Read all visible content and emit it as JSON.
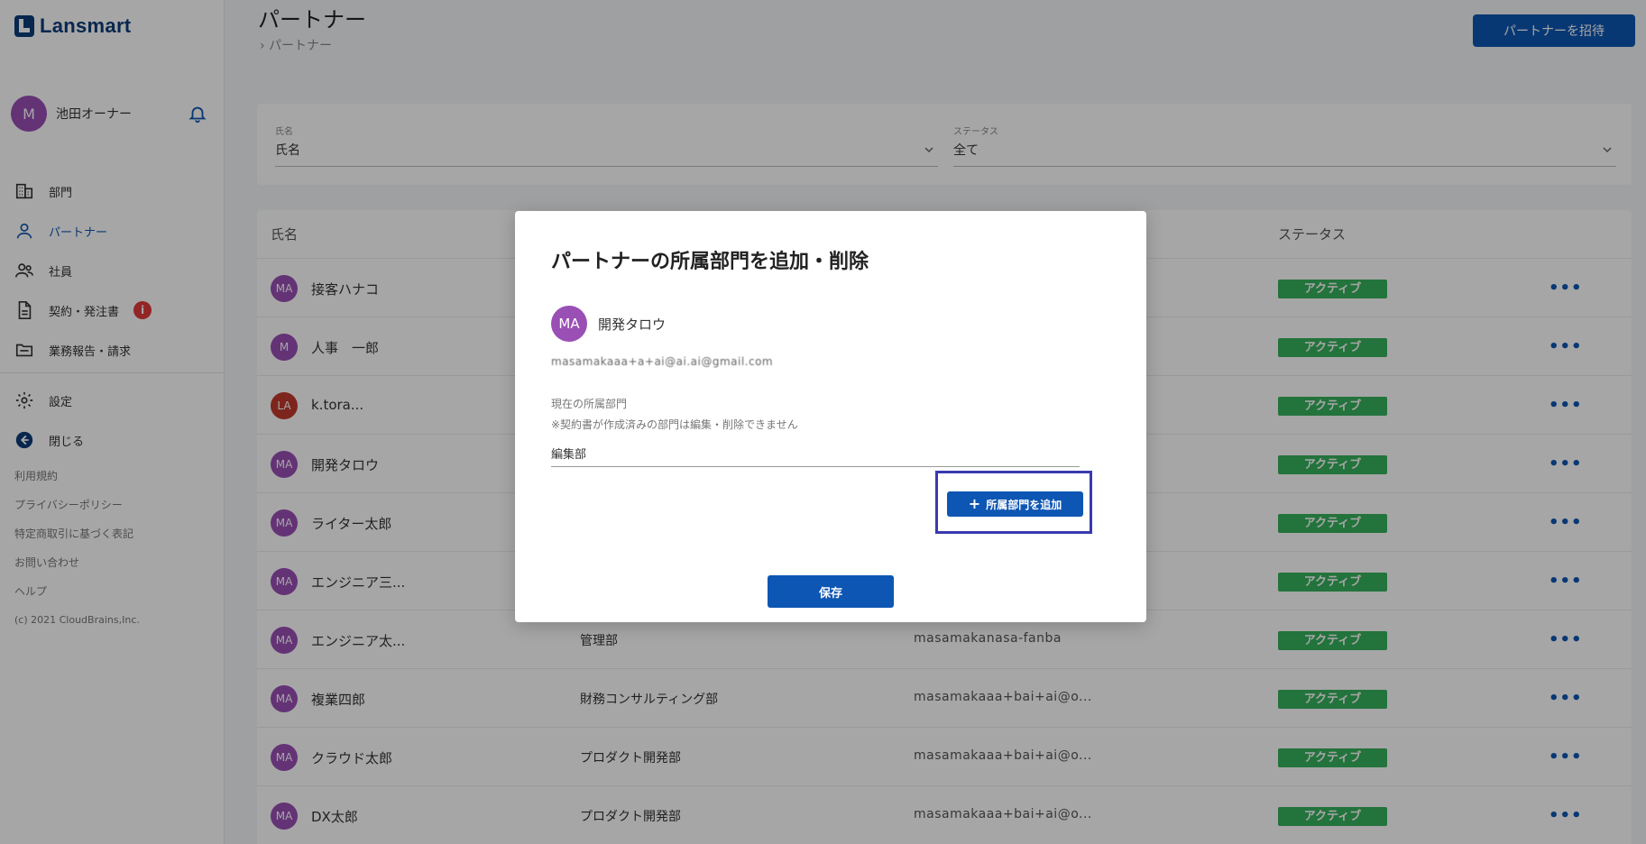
{
  "app": {
    "logo_text": "Lansmart"
  },
  "user": {
    "initial": "M",
    "name": "池田オーナー"
  },
  "nav": {
    "items": [
      {
        "label": "部門",
        "icon": "building-icon"
      },
      {
        "label": "パートナー",
        "icon": "person-icon",
        "active": true
      },
      {
        "label": "社員",
        "icon": "people-icon"
      },
      {
        "label": "契約・発注書",
        "icon": "document-icon",
        "badge": "i"
      },
      {
        "label": "業務報告・請求",
        "icon": "folder-icon"
      }
    ],
    "bottom": [
      {
        "label": "設定",
        "icon": "gear-icon"
      },
      {
        "label": "閉じる",
        "icon": "arrow-left-circle-icon"
      }
    ],
    "links": [
      "利用規約",
      "プライバシーポリシー",
      "特定商取引に基づく表記",
      "お問い合わせ",
      "ヘルプ"
    ],
    "copyright": "(c) 2021 CloudBrains,Inc."
  },
  "header": {
    "title": "パートナー",
    "breadcrumb": "パートナー",
    "invite_button": "パートナーを招待"
  },
  "filters": {
    "name_label": "氏名",
    "name_placeholder": "氏名",
    "status_label": "ステータス",
    "status_value": "全て"
  },
  "table": {
    "headers": {
      "name": "氏名",
      "status": "ステータス"
    },
    "rows": [
      {
        "initials": "MA",
        "name": "接客ハナコ",
        "dept": "",
        "email": "",
        "status": "アクティブ",
        "color": "#9a4fb5"
      },
      {
        "initials": "M",
        "name": "人事　一郎",
        "dept": "",
        "email": "",
        "status": "アクティブ",
        "color": "#9a4fb5"
      },
      {
        "initials": "LA",
        "name": "k.tora...",
        "dept": "",
        "email": "",
        "status": "アクティブ",
        "color": "#c0392b"
      },
      {
        "initials": "MA",
        "name": "開発タロウ",
        "dept": "",
        "email": "",
        "status": "アクティブ",
        "color": "#9a4fb5"
      },
      {
        "initials": "MA",
        "name": "ライター太郎",
        "dept": "",
        "email": "",
        "status": "アクティブ",
        "color": "#9a4fb5"
      },
      {
        "initials": "MA",
        "name": "エンジニア三...",
        "dept": "",
        "email": "",
        "status": "アクティブ",
        "color": "#9a4fb5"
      },
      {
        "initials": "MA",
        "name": "エンジニア太...",
        "dept": "管理部",
        "email": "masamakanasa-fanba",
        "status": "アクティブ",
        "color": "#9a4fb5"
      },
      {
        "initials": "MA",
        "name": "複業四郎",
        "dept": "財務コンサルティング部",
        "email": "masamakaaa+bai+ai@o...",
        "status": "アクティブ",
        "color": "#9a4fb5"
      },
      {
        "initials": "MA",
        "name": "クラウド太郎",
        "dept": "プロダクト開発部",
        "email": "masamakaaa+bai+ai@o...",
        "status": "アクティブ",
        "color": "#9a4fb5"
      },
      {
        "initials": "MA",
        "name": "DX太郎",
        "dept": "プロダクト開発部",
        "email": "masamakaaa+bai+ai@o...",
        "status": "アクティブ",
        "color": "#9a4fb5"
      }
    ]
  },
  "modal": {
    "title": "パートナーの所属部門を追加・削除",
    "avatar_initials": "MA",
    "partner_name": "開発タロウ",
    "partner_email": "masamakaaa+a+ai@ai.ai@gmail.com",
    "current_dept_label": "現在の所属部門",
    "note": "※契約書が作成済みの部門は編集・削除できません",
    "current_dept": "編集部",
    "add_button": "所属部門を追加",
    "save_button": "保存"
  },
  "colors": {
    "primary": "#0d56b3",
    "active_badge": "#36b15c",
    "avatar": "#9a4fb5"
  }
}
